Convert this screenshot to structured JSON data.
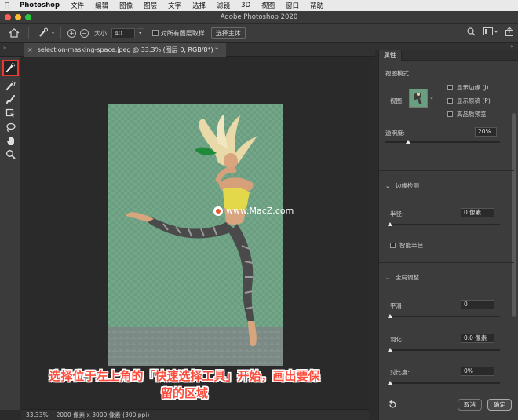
{
  "menubar": {
    "app": "Photoshop",
    "items": [
      "文件",
      "编辑",
      "图像",
      "图层",
      "文字",
      "选择",
      "滤镜",
      "3D",
      "视图",
      "窗口",
      "帮助"
    ]
  },
  "window": {
    "title": "Adobe Photoshop 2020"
  },
  "options_bar": {
    "size_label": "大小:",
    "size_value": "40",
    "sample_all_layers": "对所有图层取样",
    "select_subject": "选择主体"
  },
  "document_tab": {
    "label": "selection-masking-space.jpeg @ 33.3% (图层 0, RGB/8*) *"
  },
  "tools": [
    {
      "name": "quick-selection-tool",
      "icon": "quick-select-brush-icon",
      "active": true
    },
    {
      "name": "refine-edge-brush-tool",
      "icon": "refine-edge-brush-icon",
      "active": false
    },
    {
      "name": "brush-tool",
      "icon": "brush-icon",
      "active": false
    },
    {
      "name": "object-selection-tool",
      "icon": "object-selection-icon",
      "active": false
    },
    {
      "name": "lasso-tool",
      "icon": "lasso-icon",
      "active": false
    },
    {
      "name": "hand-tool",
      "icon": "hand-icon",
      "active": false
    },
    {
      "name": "zoom-tool",
      "icon": "zoom-icon",
      "active": false
    }
  ],
  "watermark": "www.MacZ.com",
  "caption": {
    "line1": "选择位于左上角的「快速选择工具」开始，画出要保",
    "line2": "留的区域"
  },
  "status_bar": {
    "zoom": "33.33%",
    "info": "2000 像素 x 3000 像素 (300 ppi)"
  },
  "properties": {
    "tab": "属性",
    "view_mode": {
      "title": "视图模式",
      "view_label": "视图:",
      "show_edge": "显示边缘 (J)",
      "show_original": "显示原稿 (P)",
      "hq_preview": "高品质预览"
    },
    "transparency": {
      "label": "透明度:",
      "value": "20%",
      "level": 0.2
    },
    "edge_detection": {
      "title": "边缘检测",
      "radius_label": "半径:",
      "radius_value": "0 像素",
      "radius_level": 0,
      "smart_radius": "智能半径"
    },
    "global_refine": {
      "title": "全局调整",
      "smooth_label": "平滑:",
      "smooth_value": "0",
      "feather_label": "羽化:",
      "feather_value": "0.0 像素",
      "contrast_label": "对比度:",
      "contrast_value": "0%"
    },
    "buttons": {
      "cancel": "取消",
      "ok": "确定"
    }
  },
  "colors": {
    "highlight": "#e83a2f",
    "caption": "#ff4d3d",
    "canvas_overlay": "#6a9e80"
  }
}
